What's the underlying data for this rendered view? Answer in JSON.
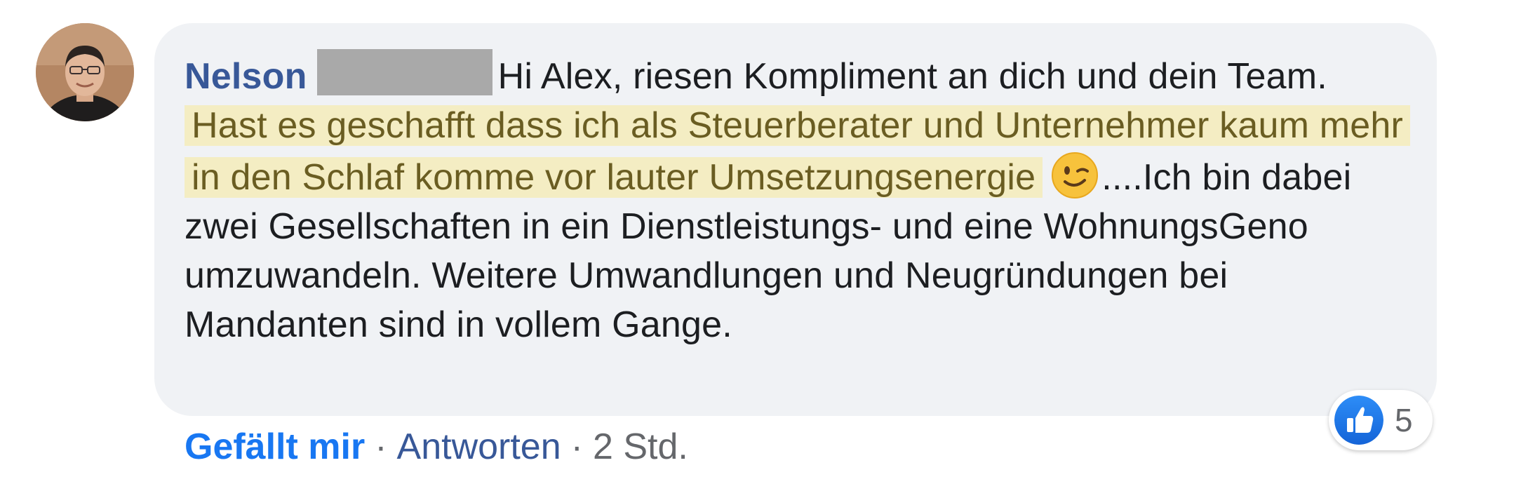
{
  "comment": {
    "author": "Nelson",
    "text_before": "Hi Alex, riesen Kompliment an dich und dein Team.",
    "highlighted": "Hast es geschafft dass ich als Steuerberater und Unternehmer kaum mehr in den Schlaf komme vor lauter Umsetzungsenergie",
    "emoji": "winking-face-emoji",
    "text_after": "....Ich bin dabei zwei Gesellschaften in ein Dienstleistungs- und eine WohnungsGeno umzuwandeln. Weitere Umwandlungen und Neugründungen bei Mandanten sind in vollem Gange."
  },
  "reactions": {
    "icon": "thumbs-up-icon",
    "count": "5"
  },
  "actions": {
    "like_label": "Gefällt mir",
    "separator": "·",
    "reply_label": "Antworten",
    "timestamp": "2 Std."
  },
  "colors": {
    "author": "#385898",
    "like_link": "#1877f2",
    "highlight_bg": "#f4edc3",
    "highlight_text": "#6a5d22",
    "bubble_bg": "#f0f2f5"
  }
}
